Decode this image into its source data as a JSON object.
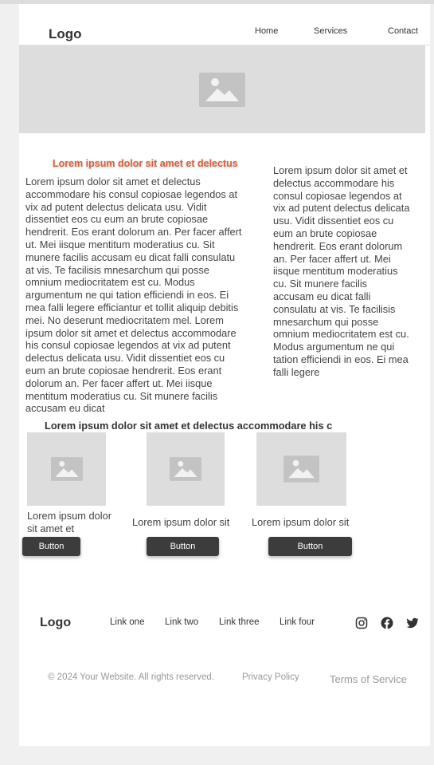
{
  "header": {
    "logo": "Logo",
    "nav": [
      "Home",
      "Services",
      "Contact"
    ]
  },
  "hero": {
    "image_icon": "image-placeholder-icon"
  },
  "content": {
    "heading": "Lorem ipsum dolor sit amet et delectus",
    "left_text": "Lorem ipsum dolor sit amet et delectus accommodare his consul copiosae legendos at vix ad putent delectus delicata usu. Vidit dissentiet eos cu eum an brute copiosae hendrerit. Eos erant dolorum an. Per facer affert ut. Mei iisque mentitum moderatius cu. Sit munere facilis accusam eu dicat falli consulatu at vis. Te facilisis mnesarchum qui posse omnium mediocritatem est cu. Modus argumentum ne qui tation efficiendi in eos. Ei mea falli legere efficiantur et tollit aliquip debitis mei. No deserunt mediocritatem mel. Lorem ipsum dolor sit amet et delectus accommodare his consul copiosae legendos at vix ad putent delectus delicata usu. Vidit dissentiet eos cu eum an brute copiosae hendrerit. Eos erant dolorum an. Per facer affert ut. Mei iisque mentitum moderatius cu. Sit munere facilis accusam eu dicat",
    "right_text": "Lorem ipsum dolor sit amet et delectus accommodare his consul copiosae legendos at vix ad putent delectus delicata usu. Vidit dissentiet eos cu eum an brute copiosae hendrerit. Eos erant dolorum an. Per facer affert ut. Mei iisque mentitum moderatius cu. Sit munere facilis accusam eu dicat falli consulatu at vis. Te facilisis mnesarchum qui posse omnium mediocritatem est cu. Modus argumentum ne qui tation efficiendi in eos. Ei mea falli legere",
    "row_heading": "Lorem ipsum dolor sit amet et delectus accommodare his c"
  },
  "cards": [
    {
      "text": "Lorem ipsum dolor sit amet et",
      "button": "Button"
    },
    {
      "text": "Lorem ipsum dolor sit",
      "button": "Button"
    },
    {
      "text": "Lorem ipsum dolor sit",
      "button": "Button"
    }
  ],
  "footer": {
    "logo": "Logo",
    "links": [
      "Link one",
      "Link two",
      "Link three",
      "Link four"
    ],
    "social_icons": [
      "instagram-icon",
      "facebook-icon",
      "twitter-icon"
    ],
    "copyright": "© 2024 Your Website. All rights reserved.",
    "privacy": "Privacy Policy",
    "terms": "Terms of Service"
  },
  "colors": {
    "accent_heading": "#d9603f",
    "button_bg": "#3c3c3c",
    "placeholder_bg": "#dddddd"
  }
}
